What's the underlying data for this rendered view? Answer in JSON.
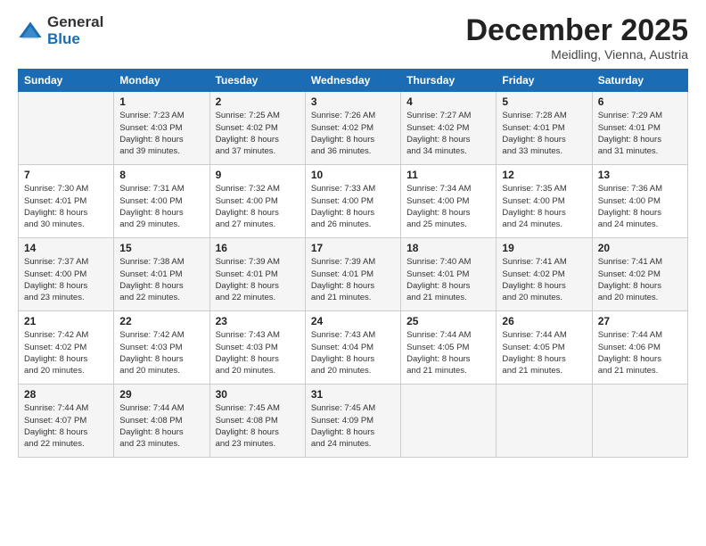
{
  "logo": {
    "general": "General",
    "blue": "Blue"
  },
  "title": "December 2025",
  "location": "Meidling, Vienna, Austria",
  "days_of_week": [
    "Sunday",
    "Monday",
    "Tuesday",
    "Wednesday",
    "Thursday",
    "Friday",
    "Saturday"
  ],
  "weeks": [
    [
      {
        "day": "",
        "info": ""
      },
      {
        "day": "1",
        "info": "Sunrise: 7:23 AM\nSunset: 4:03 PM\nDaylight: 8 hours\nand 39 minutes."
      },
      {
        "day": "2",
        "info": "Sunrise: 7:25 AM\nSunset: 4:02 PM\nDaylight: 8 hours\nand 37 minutes."
      },
      {
        "day": "3",
        "info": "Sunrise: 7:26 AM\nSunset: 4:02 PM\nDaylight: 8 hours\nand 36 minutes."
      },
      {
        "day": "4",
        "info": "Sunrise: 7:27 AM\nSunset: 4:02 PM\nDaylight: 8 hours\nand 34 minutes."
      },
      {
        "day": "5",
        "info": "Sunrise: 7:28 AM\nSunset: 4:01 PM\nDaylight: 8 hours\nand 33 minutes."
      },
      {
        "day": "6",
        "info": "Sunrise: 7:29 AM\nSunset: 4:01 PM\nDaylight: 8 hours\nand 31 minutes."
      }
    ],
    [
      {
        "day": "7",
        "info": "Sunrise: 7:30 AM\nSunset: 4:01 PM\nDaylight: 8 hours\nand 30 minutes."
      },
      {
        "day": "8",
        "info": "Sunrise: 7:31 AM\nSunset: 4:00 PM\nDaylight: 8 hours\nand 29 minutes."
      },
      {
        "day": "9",
        "info": "Sunrise: 7:32 AM\nSunset: 4:00 PM\nDaylight: 8 hours\nand 27 minutes."
      },
      {
        "day": "10",
        "info": "Sunrise: 7:33 AM\nSunset: 4:00 PM\nDaylight: 8 hours\nand 26 minutes."
      },
      {
        "day": "11",
        "info": "Sunrise: 7:34 AM\nSunset: 4:00 PM\nDaylight: 8 hours\nand 25 minutes."
      },
      {
        "day": "12",
        "info": "Sunrise: 7:35 AM\nSunset: 4:00 PM\nDaylight: 8 hours\nand 24 minutes."
      },
      {
        "day": "13",
        "info": "Sunrise: 7:36 AM\nSunset: 4:00 PM\nDaylight: 8 hours\nand 24 minutes."
      }
    ],
    [
      {
        "day": "14",
        "info": "Sunrise: 7:37 AM\nSunset: 4:00 PM\nDaylight: 8 hours\nand 23 minutes."
      },
      {
        "day": "15",
        "info": "Sunrise: 7:38 AM\nSunset: 4:01 PM\nDaylight: 8 hours\nand 22 minutes."
      },
      {
        "day": "16",
        "info": "Sunrise: 7:39 AM\nSunset: 4:01 PM\nDaylight: 8 hours\nand 22 minutes."
      },
      {
        "day": "17",
        "info": "Sunrise: 7:39 AM\nSunset: 4:01 PM\nDaylight: 8 hours\nand 21 minutes."
      },
      {
        "day": "18",
        "info": "Sunrise: 7:40 AM\nSunset: 4:01 PM\nDaylight: 8 hours\nand 21 minutes."
      },
      {
        "day": "19",
        "info": "Sunrise: 7:41 AM\nSunset: 4:02 PM\nDaylight: 8 hours\nand 20 minutes."
      },
      {
        "day": "20",
        "info": "Sunrise: 7:41 AM\nSunset: 4:02 PM\nDaylight: 8 hours\nand 20 minutes."
      }
    ],
    [
      {
        "day": "21",
        "info": "Sunrise: 7:42 AM\nSunset: 4:02 PM\nDaylight: 8 hours\nand 20 minutes."
      },
      {
        "day": "22",
        "info": "Sunrise: 7:42 AM\nSunset: 4:03 PM\nDaylight: 8 hours\nand 20 minutes."
      },
      {
        "day": "23",
        "info": "Sunrise: 7:43 AM\nSunset: 4:03 PM\nDaylight: 8 hours\nand 20 minutes."
      },
      {
        "day": "24",
        "info": "Sunrise: 7:43 AM\nSunset: 4:04 PM\nDaylight: 8 hours\nand 20 minutes."
      },
      {
        "day": "25",
        "info": "Sunrise: 7:44 AM\nSunset: 4:05 PM\nDaylight: 8 hours\nand 21 minutes."
      },
      {
        "day": "26",
        "info": "Sunrise: 7:44 AM\nSunset: 4:05 PM\nDaylight: 8 hours\nand 21 minutes."
      },
      {
        "day": "27",
        "info": "Sunrise: 7:44 AM\nSunset: 4:06 PM\nDaylight: 8 hours\nand 21 minutes."
      }
    ],
    [
      {
        "day": "28",
        "info": "Sunrise: 7:44 AM\nSunset: 4:07 PM\nDaylight: 8 hours\nand 22 minutes."
      },
      {
        "day": "29",
        "info": "Sunrise: 7:44 AM\nSunset: 4:08 PM\nDaylight: 8 hours\nand 23 minutes."
      },
      {
        "day": "30",
        "info": "Sunrise: 7:45 AM\nSunset: 4:08 PM\nDaylight: 8 hours\nand 23 minutes."
      },
      {
        "day": "31",
        "info": "Sunrise: 7:45 AM\nSunset: 4:09 PM\nDaylight: 8 hours\nand 24 minutes."
      },
      {
        "day": "",
        "info": ""
      },
      {
        "day": "",
        "info": ""
      },
      {
        "day": "",
        "info": ""
      }
    ]
  ]
}
